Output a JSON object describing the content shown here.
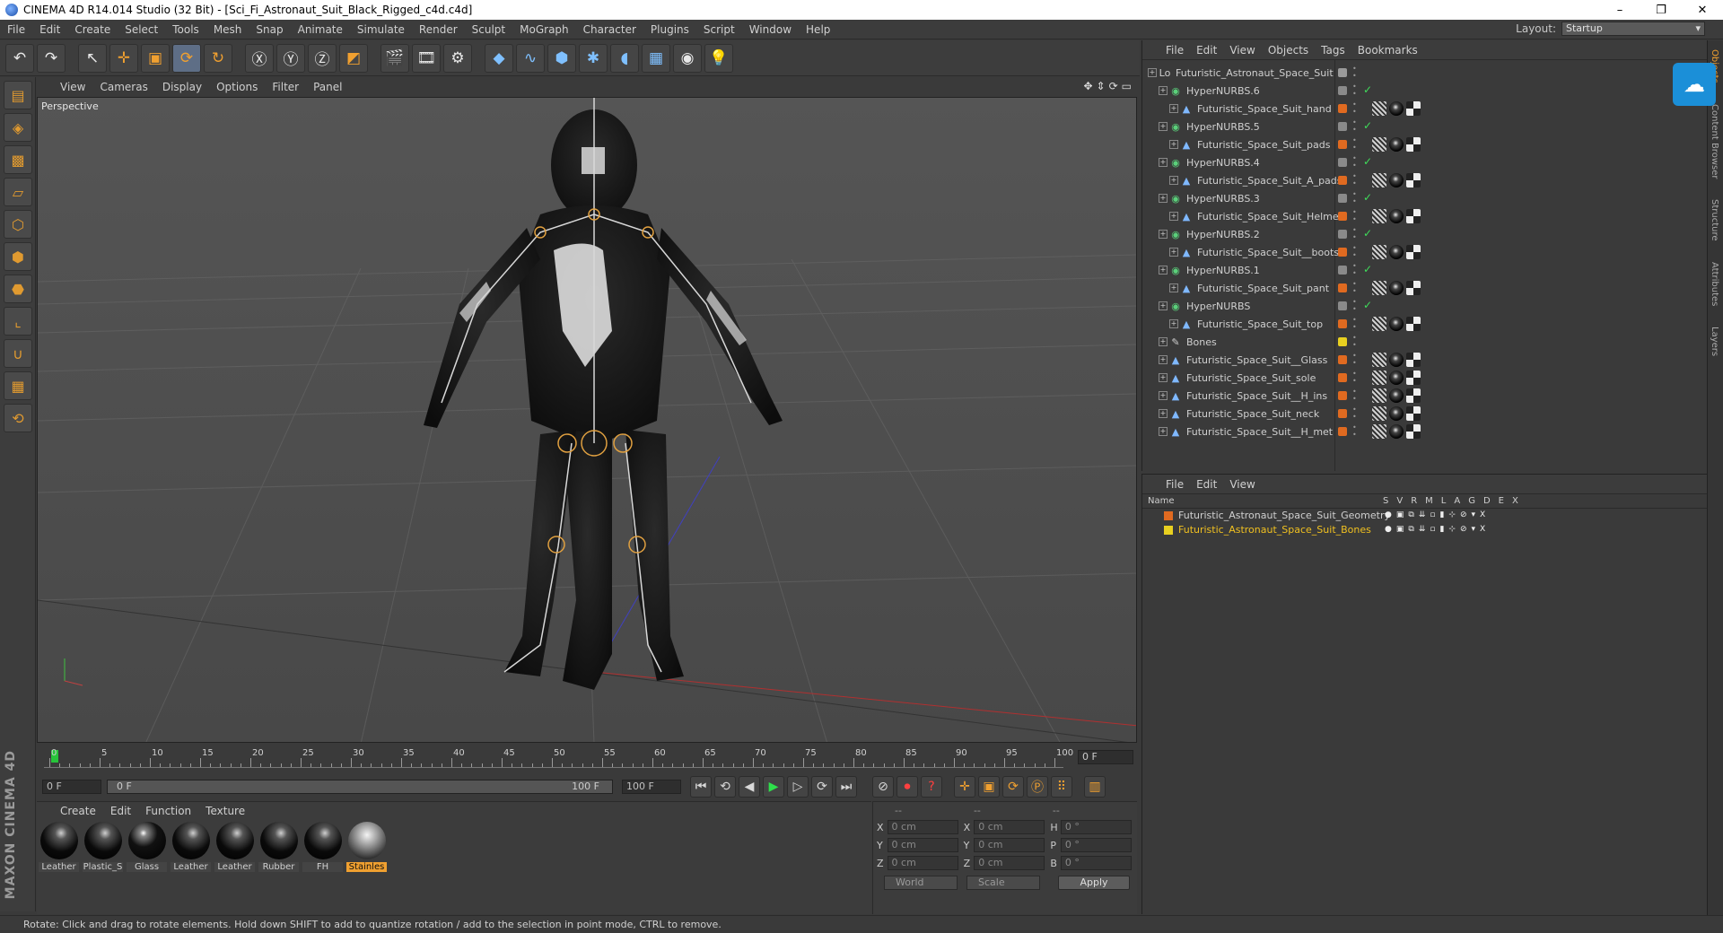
{
  "window": {
    "title": "CINEMA 4D R14.014 Studio (32 Bit) - [Sci_Fi_Astronaut_Suit_Black_Rigged_c4d.c4d]",
    "controls": [
      "–",
      "❐",
      "✕"
    ]
  },
  "menubar": {
    "items": [
      "File",
      "Edit",
      "Create",
      "Select",
      "Tools",
      "Mesh",
      "Snap",
      "Animate",
      "Simulate",
      "Render",
      "Sculpt",
      "MoGraph",
      "Character",
      "Plugins",
      "Script",
      "Window",
      "Help"
    ],
    "layout_label": "Layout:",
    "layout_value": "Startup"
  },
  "viewport": {
    "menu": [
      "View",
      "Cameras",
      "Display",
      "Options",
      "Filter",
      "Panel"
    ],
    "label": "Perspective"
  },
  "timeline": {
    "ticks": [
      "0",
      "5",
      "10",
      "15",
      "20",
      "25",
      "30",
      "35",
      "40",
      "45",
      "50",
      "55",
      "60",
      "65",
      "70",
      "75",
      "80",
      "85",
      "90",
      "95",
      "100"
    ],
    "current_frame": "0 F",
    "start_field": "0 F",
    "range_start": "0 F",
    "range_end": "100 F",
    "end_field": "100 F"
  },
  "materials": {
    "menu": [
      "Create",
      "Edit",
      "Function",
      "Texture"
    ],
    "items": [
      {
        "label": "Leather",
        "kind": "ball"
      },
      {
        "label": "Plastic_S",
        "kind": "ball"
      },
      {
        "label": "Glass",
        "kind": "glass"
      },
      {
        "label": "Leather",
        "kind": "ball"
      },
      {
        "label": "Leather",
        "kind": "ball"
      },
      {
        "label": "Rubber",
        "kind": "ball"
      },
      {
        "label": "FH",
        "kind": "ball"
      },
      {
        "label": "Stainles",
        "kind": "stainless",
        "selected": true
      }
    ]
  },
  "coords": {
    "headers": [
      "--",
      "--",
      "--"
    ],
    "rows": [
      {
        "a1": "X",
        "v1": "0 cm",
        "a2": "X",
        "v2": "0 cm",
        "a3": "H",
        "v3": "0 °"
      },
      {
        "a1": "Y",
        "v1": "0 cm",
        "a2": "Y",
        "v2": "0 cm",
        "a3": "P",
        "v3": "0 °"
      },
      {
        "a1": "Z",
        "v1": "0 cm",
        "a2": "Z",
        "v2": "0 cm",
        "a3": "B",
        "v3": "0 °"
      }
    ],
    "mode1": "World",
    "mode2": "Scale",
    "apply": "Apply"
  },
  "status": "Rotate: Click and drag to rotate elements. Hold down SHIFT to add to quantize rotation / add to the selection in point mode, CTRL to remove.",
  "object_manager": {
    "menu": [
      "File",
      "Edit",
      "View",
      "Objects",
      "Tags",
      "Bookmarks"
    ],
    "objects": [
      {
        "name": "Futuristic_Astronaut_Space_Suit",
        "indent": 0,
        "icon": "null",
        "color": "#9a9a9a"
      },
      {
        "name": "HyperNURBS.6",
        "indent": 1,
        "icon": "nurbs",
        "color": "#8a8a8a",
        "check": true
      },
      {
        "name": "Futuristic_Space_Suit_hand",
        "indent": 2,
        "icon": "poly",
        "color": "#e06a20",
        "tags": true
      },
      {
        "name": "HyperNURBS.5",
        "indent": 1,
        "icon": "nurbs",
        "color": "#8a8a8a",
        "check": true
      },
      {
        "name": "Futuristic_Space_Suit_pads",
        "indent": 2,
        "icon": "poly",
        "color": "#e06a20",
        "tags": true
      },
      {
        "name": "HyperNURBS.4",
        "indent": 1,
        "icon": "nurbs",
        "color": "#8a8a8a",
        "check": true
      },
      {
        "name": "Futuristic_Space_Suit_A_pads",
        "indent": 2,
        "icon": "poly",
        "color": "#e06a20",
        "tags": true
      },
      {
        "name": "HyperNURBS.3",
        "indent": 1,
        "icon": "nurbs",
        "color": "#8a8a8a",
        "check": true
      },
      {
        "name": "Futuristic_Space_Suit_Helmet",
        "indent": 2,
        "icon": "poly",
        "color": "#e06a20",
        "tags": true
      },
      {
        "name": "HyperNURBS.2",
        "indent": 1,
        "icon": "nurbs",
        "color": "#8a8a8a",
        "check": true
      },
      {
        "name": "Futuristic_Space_Suit__boots",
        "indent": 2,
        "icon": "poly",
        "color": "#e06a20",
        "tags": true
      },
      {
        "name": "HyperNURBS.1",
        "indent": 1,
        "icon": "nurbs",
        "color": "#8a8a8a",
        "check": true
      },
      {
        "name": "Futuristic_Space_Suit_pant",
        "indent": 2,
        "icon": "poly",
        "color": "#e06a20",
        "tags": true
      },
      {
        "name": "HyperNURBS",
        "indent": 1,
        "icon": "nurbs",
        "color": "#8a8a8a",
        "check": true
      },
      {
        "name": "Futuristic_Space_Suit_top",
        "indent": 2,
        "icon": "poly",
        "color": "#e06a20",
        "tags": true
      },
      {
        "name": "Bones",
        "indent": 1,
        "icon": "bone",
        "color": "#e8d020"
      },
      {
        "name": "Futuristic_Space_Suit__Glass",
        "indent": 1,
        "icon": "poly",
        "color": "#e06a20",
        "tags": true
      },
      {
        "name": "Futuristic_Space_Suit_sole",
        "indent": 1,
        "icon": "poly",
        "color": "#e06a20",
        "tags": true
      },
      {
        "name": "Futuristic_Space_Suit__H_ins",
        "indent": 1,
        "icon": "poly",
        "color": "#e06a20",
        "tags": true
      },
      {
        "name": "Futuristic_Space_Suit_neck",
        "indent": 1,
        "icon": "poly",
        "color": "#e06a20",
        "tags": true
      },
      {
        "name": "Futuristic_Space_Suit__H_met",
        "indent": 1,
        "icon": "poly",
        "color": "#e06a20",
        "tags": true
      }
    ]
  },
  "layer_manager": {
    "menu": [
      "File",
      "Edit",
      "View"
    ],
    "name_header": "Name",
    "col_headers": [
      "S",
      "V",
      "R",
      "M",
      "L",
      "A",
      "G",
      "D",
      "E",
      "X"
    ],
    "layers": [
      {
        "name": "Futuristic_Astronaut_Space_Suit_Geometry",
        "color": "#e06a20",
        "selected": false
      },
      {
        "name": "Futuristic_Astronaut_Space_Suit_Bones",
        "color": "#e8d020",
        "selected": true
      }
    ]
  },
  "side_tabs": [
    "Objects",
    "Content Browser",
    "Structure",
    "Attributes",
    "Layers"
  ]
}
